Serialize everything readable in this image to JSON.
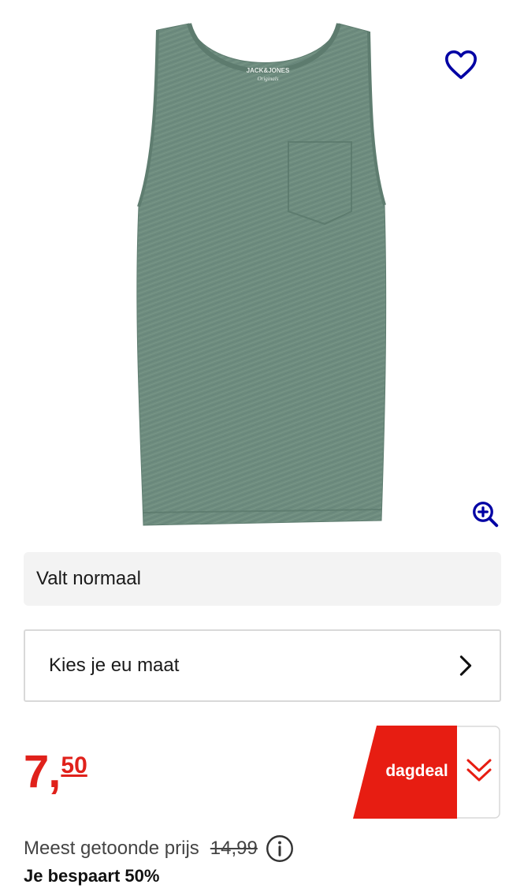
{
  "product": {
    "image_alt": "Green sleeveless tank top with chest pocket",
    "brand_label_line1": "JACK&JONES",
    "brand_label_line2": "Originals"
  },
  "actions": {
    "wishlist_icon": "heart-outline-icon",
    "zoom_icon": "zoom-in-icon"
  },
  "fit": {
    "label": "Valt normaal"
  },
  "size_selector": {
    "label": "Kies je eu maat",
    "icon": "chevron-right-icon"
  },
  "price": {
    "integer": "7",
    "separator": ",",
    "decimals": "50"
  },
  "deal": {
    "label": "dagdeal",
    "icon": "double-chevron-down-icon"
  },
  "reference_price": {
    "label": "Meest getoonde prijs",
    "old_price": "14,99",
    "icon": "info-icon"
  },
  "savings": {
    "label": "Je bespaart 50%"
  },
  "colors": {
    "accent_blue": "#0000a4",
    "price_red": "#e0211b",
    "deal_red": "#e71d12",
    "shirt_green": "#6b8a7c"
  }
}
